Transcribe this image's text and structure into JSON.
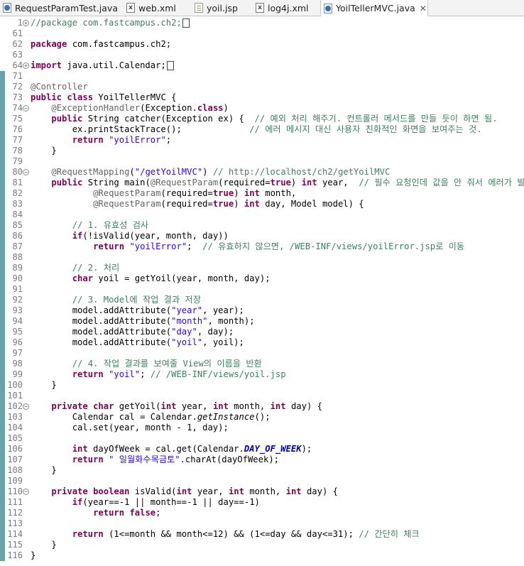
{
  "tabs": [
    {
      "label": "RequestParamTest.java",
      "type": "java"
    },
    {
      "label": "web.xml",
      "type": "xml"
    },
    {
      "label": "yoil.jsp",
      "type": "jsp"
    },
    {
      "label": "log4j.xml",
      "type": "xml"
    },
    {
      "label": "YoilTellerMVC.java",
      "type": "java",
      "active": true
    }
  ],
  "lines": [
    {
      "n": "1",
      "fold": "+",
      "t": "//package com.fastcampus.ch2;",
      "kind": "cmt",
      "box": true
    },
    {
      "n": "61",
      "t": ""
    },
    {
      "n": "62",
      "t": "package com.fastcampus.ch2;",
      "kind": "package"
    },
    {
      "n": "63",
      "t": ""
    },
    {
      "n": "64",
      "fold": "+",
      "t": "import java.util.Calendar;",
      "kind": "import",
      "box": true
    },
    {
      "n": "71",
      "t": ""
    },
    {
      "n": "72",
      "t": "@Controller",
      "kind": "ann"
    },
    {
      "n": "73",
      "t": "public class YoilTellerMVC {",
      "kind": "class"
    },
    {
      "n": "74",
      "fold": "-",
      "t": "    @ExceptionHandler(Exception.class)",
      "kind": "exh"
    },
    {
      "n": "75",
      "t": "    public String catcher(Exception ex) {  // 예외 처리 해주기. 컨트롤러 메서드를 만들 듯이 하면 됨.",
      "kind": "catcher"
    },
    {
      "n": "76",
      "t": "        ex.printStackTrace();             // 에러 메시지 대신 사용자 친화적인 화면을 보여주는 것.",
      "kind": "pst"
    },
    {
      "n": "77",
      "t": "        return \"yoilError\";",
      "kind": "retstr"
    },
    {
      "n": "78",
      "t": "    }"
    },
    {
      "n": "79",
      "t": ""
    },
    {
      "n": "80",
      "fold": "-",
      "t": "    @RequestMapping(\"/getYoilMVC\") // http://localhost/ch2/getYoilMVC",
      "kind": "reqmap"
    },
    {
      "n": "81",
      "t": "    public String main(@RequestParam(required=true) int year,  // 필수 요청인데 값을 안 줘서 에러가 발생함.",
      "kind": "main"
    },
    {
      "n": "82",
      "t": "            @RequestParam(required=true) int month,",
      "kind": "rp"
    },
    {
      "n": "83",
      "t": "            @RequestParam(required=true) int day, Model model) {",
      "kind": "rp"
    },
    {
      "n": "84",
      "t": ""
    },
    {
      "n": "85",
      "t": "        // 1. 유효성 검사",
      "kind": "cmt"
    },
    {
      "n": "86",
      "t": "        if(!isValid(year, month, day))",
      "kind": "if"
    },
    {
      "n": "87",
      "t": "            return \"yoilError\";  // 유효하지 않으면, /WEB-INF/views/yoilError.jsp로 이동",
      "kind": "ret87"
    },
    {
      "n": "88",
      "t": ""
    },
    {
      "n": "89",
      "t": "        // 2. 처리",
      "kind": "cmt"
    },
    {
      "n": "90",
      "t": "        char yoil = getYoil(year, month, day);",
      "kind": "char"
    },
    {
      "n": "91",
      "t": ""
    },
    {
      "n": "92",
      "t": "        // 3. Model에 작업 결과 저장",
      "kind": "cmt"
    },
    {
      "n": "93",
      "t": "        model.addAttribute(\"year\", year);",
      "kind": "addattr"
    },
    {
      "n": "94",
      "t": "        model.addAttribute(\"month\", month);",
      "kind": "addattr"
    },
    {
      "n": "95",
      "t": "        model.addAttribute(\"day\", day);",
      "kind": "addattr"
    },
    {
      "n": "96",
      "t": "        model.addAttribute(\"yoil\", yoil);",
      "kind": "addattr"
    },
    {
      "n": "97",
      "t": ""
    },
    {
      "n": "98",
      "t": "        // 4. 작업 결과를 보여줄 View의 이름을 반환",
      "kind": "cmt"
    },
    {
      "n": "99",
      "t": "        return \"yoil\"; // /WEB-INF/views/yoil.jsp",
      "kind": "ret99"
    },
    {
      "n": "100",
      "t": "    }"
    },
    {
      "n": "101",
      "t": ""
    },
    {
      "n": "102",
      "fold": "-",
      "t": "    private char getYoil(int year, int month, int day) {",
      "kind": "getyoil"
    },
    {
      "n": "103",
      "t": "        Calendar cal = Calendar.getInstance();",
      "kind": "calinst"
    },
    {
      "n": "104",
      "t": "        cal.set(year, month - 1, day);"
    },
    {
      "n": "105",
      "t": ""
    },
    {
      "n": "106",
      "t": "        int dayOfWeek = cal.get(Calendar.DAY_OF_WEEK);",
      "kind": "dow"
    },
    {
      "n": "107",
      "t": "        return \" 일월화수목금토\".charAt(dayOfWeek);",
      "kind": "ret107"
    },
    {
      "n": "108",
      "t": "    }"
    },
    {
      "n": "109",
      "t": ""
    },
    {
      "n": "110",
      "fold": "-",
      "t": "    private boolean isValid(int year, int month, int day) {",
      "kind": "isvalid"
    },
    {
      "n": "111",
      "t": "        if(year==-1 || month==-1 || day==-1)",
      "kind": "if111"
    },
    {
      "n": "112",
      "t": "            return false;",
      "kind": "retfalse"
    },
    {
      "n": "113",
      "t": ""
    },
    {
      "n": "114",
      "t": "        return (1<=month && month<=12) && (1<=day && day<=31); // 간단히 체크",
      "kind": "ret114"
    },
    {
      "n": "115",
      "t": "    }"
    },
    {
      "n": "116",
      "t": "}",
      "kind": "last"
    }
  ]
}
